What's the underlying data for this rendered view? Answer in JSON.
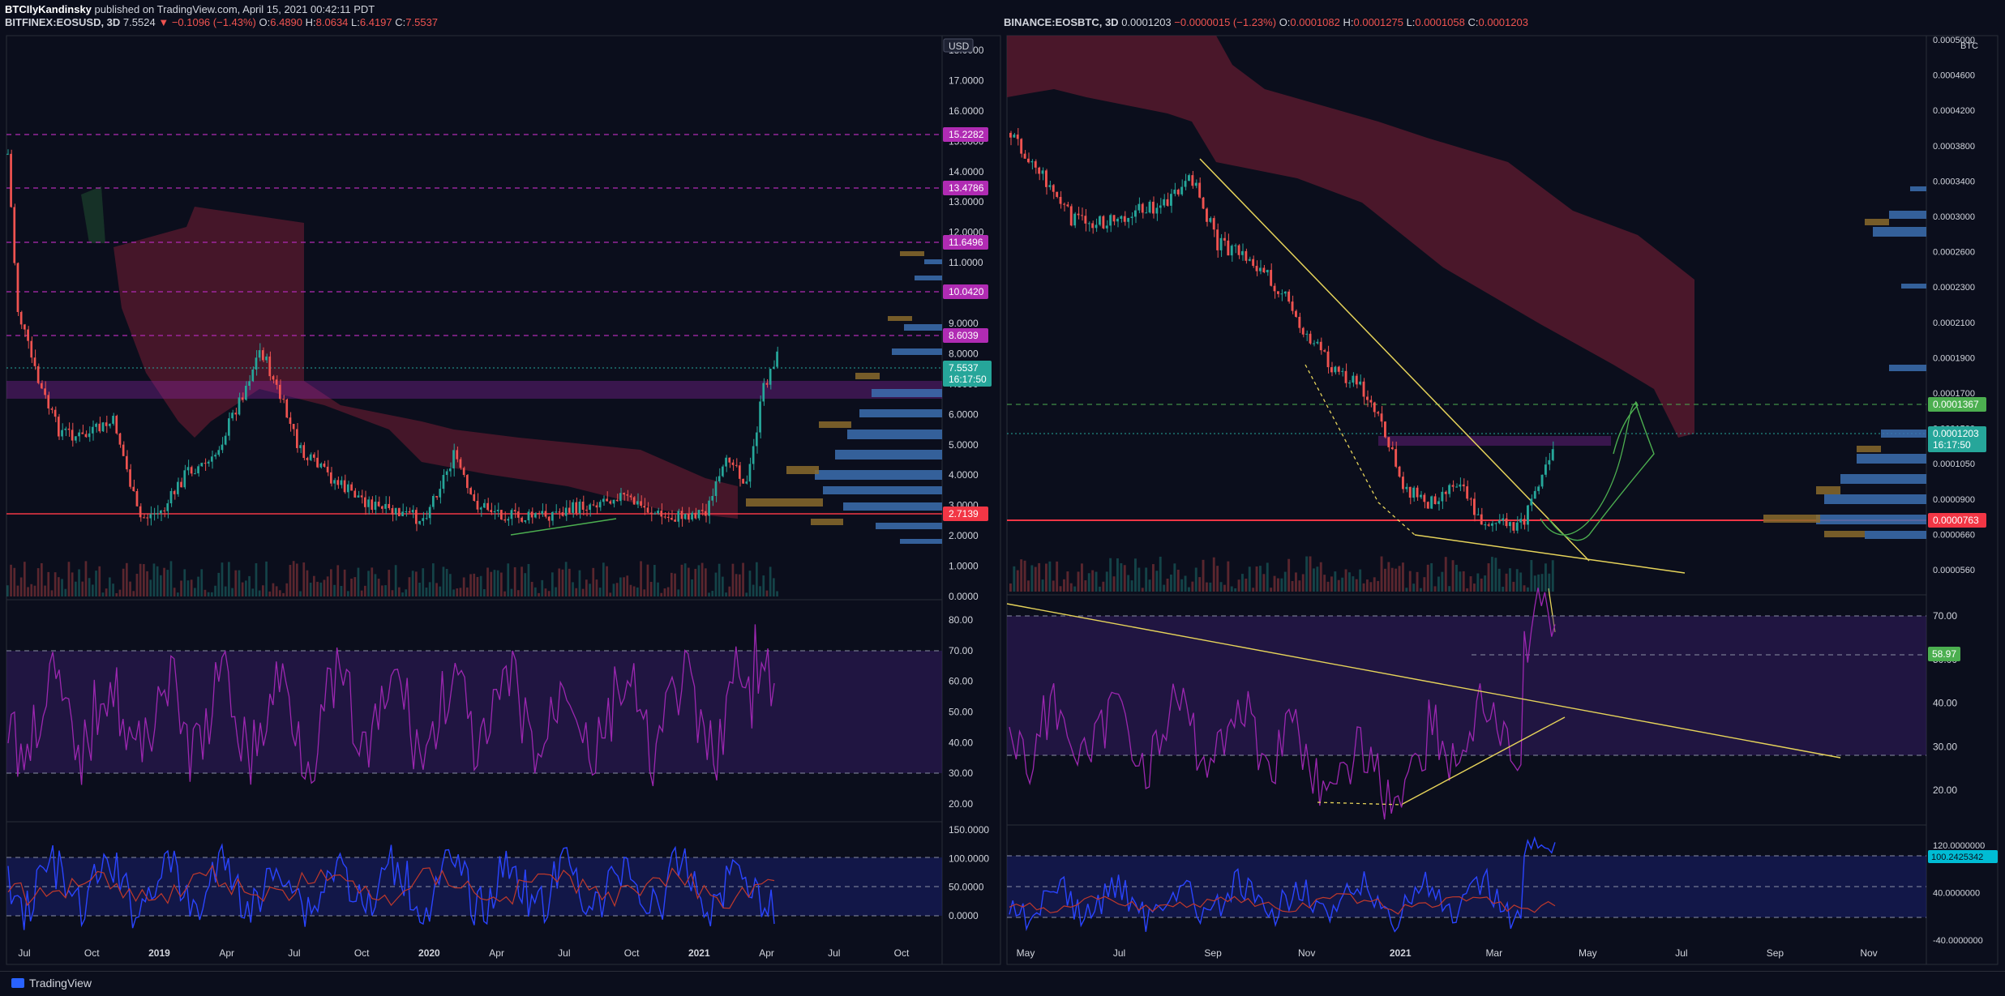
{
  "header": {
    "publisher": "BTCIlyKandinsky",
    "published_text": "published on TradingView.com, April 15, 2021 00:42:11 PDT"
  },
  "left_chart": {
    "symbol": "BITFINEX:EOSUSD, 3D",
    "last": "7.5524",
    "change": "−0.1096 (−1.43%)",
    "o_label": "O:",
    "o": "6.4890",
    "h_label": "H:",
    "h": "8.0634",
    "l_label": "L:",
    "l": "6.4197",
    "c_label": "C:",
    "c": "7.5537",
    "currency": "USD",
    "price_ticks": [
      "18.0000",
      "17.0000",
      "16.0000",
      "15.0000",
      "14.0000",
      "13.0000",
      "12.0000",
      "11.0000",
      "10.0000",
      "9.0000",
      "8.0000",
      "7.0000",
      "6.0000",
      "5.0000",
      "4.0000",
      "3.0000",
      "2.0000",
      "1.0000",
      "0.0000"
    ],
    "level_badges": [
      "15.2282",
      "13.4786",
      "11.6496",
      "10.0420",
      "8.6039"
    ],
    "last_badge": "7.5537",
    "countdown": "16:17:50",
    "support_badge": "2.7139",
    "rsi_ticks": [
      "80.00",
      "70.00",
      "60.00",
      "50.00",
      "40.00",
      "30.00",
      "20.00"
    ],
    "cci_ticks": [
      "150.0000",
      "100.0000",
      "50.0000",
      "0.0000"
    ],
    "time_ticks": [
      "Jul",
      "Oct",
      "2019",
      "Apr",
      "Jul",
      "Oct",
      "2020",
      "Apr",
      "Jul",
      "Oct",
      "2021",
      "Apr",
      "Jul",
      "Oct"
    ]
  },
  "right_chart": {
    "symbol": "BINANCE:EOSBTC, 3D",
    "last": "0.0001203",
    "change": "−0.0000015 (−1.23%)",
    "o_label": "O:",
    "o": "0.0001082",
    "h_label": "H:",
    "h": "0.0001275",
    "l_label": "L:",
    "l": "0.0001058",
    "c_label": "C:",
    "c": "0.0001203",
    "currency": "BTC",
    "price_ticks": [
      "0.0005000",
      "0.0004600",
      "0.0004200",
      "0.0003800",
      "0.0003400",
      "0.0003000",
      "0.0002600",
      "0.0002300",
      "0.0002100",
      "0.0001900",
      "0.0001700",
      "0.0001500",
      "0.0001050",
      "0.0000900",
      "0.0000660",
      "0.0000560"
    ],
    "target_badge": "0.0001367",
    "last_badge": "0.0001203",
    "countdown": "16:17:50",
    "support_badge": "0.0000763",
    "rsi_ticks": [
      "70.00",
      "50.00",
      "40.00",
      "30.00",
      "20.00"
    ],
    "rsi_badge": "58.97",
    "cci_ticks": [
      "120.0000000",
      "40.0000000",
      "-40.0000000"
    ],
    "cci_badge": "100.2425342",
    "time_ticks": [
      "May",
      "Jul",
      "Sep",
      "Nov",
      "2021",
      "Mar",
      "May",
      "Jul",
      "Sep",
      "Nov"
    ]
  },
  "footer": {
    "brand": "TradingView"
  },
  "colors": {
    "background": "#0b0e1c",
    "cloud": "#5a1a2e",
    "candle_up": "#26a69a",
    "candle_down": "#ef5350",
    "rsi": "#9c27b0",
    "level": "#b02bb3",
    "trendline": "#e6d35a",
    "support": "#f23645"
  }
}
